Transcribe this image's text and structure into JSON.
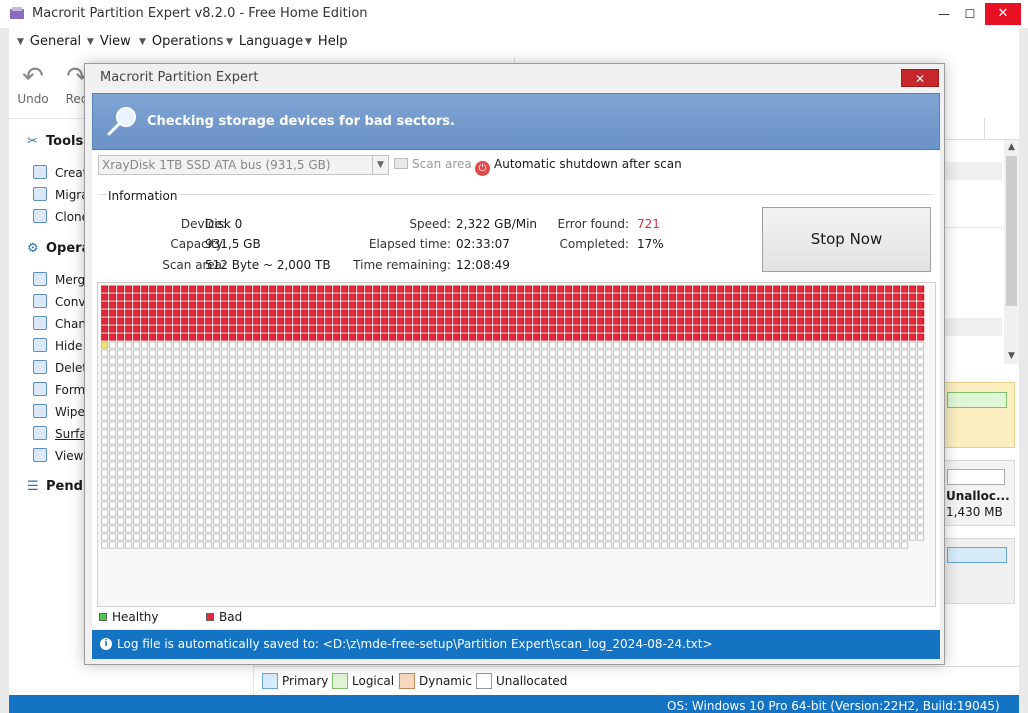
{
  "window": {
    "title": "Macrorit Partition Expert v8.2.0 - Free Home Edition",
    "minimize": "—",
    "maximize": "☐",
    "close": "✕"
  },
  "menu": [
    "General",
    "View",
    "Operations",
    "Language",
    "Help"
  ],
  "toolbar": {
    "undo": "Undo",
    "redo": "Red"
  },
  "sidebar": {
    "tools_header": "Tools",
    "tools_items": [
      "Creat",
      "Migra",
      "Clone"
    ],
    "operations_header": "Operat",
    "operations_items": [
      "Merg",
      "Conv",
      "Chan",
      "Hide",
      "Delet",
      "Form",
      "Wipe",
      "Surfa",
      "View"
    ],
    "pending_header": "Pendin"
  },
  "disk_map": {
    "unalloc_name": "Unalloc...",
    "unalloc_size": "1,430 MB"
  },
  "legend": {
    "primary": "Primary",
    "logical": "Logical",
    "dynamic": "Dynamic",
    "unallocated": "Unallocated"
  },
  "status_bar": "OS: Windows 10 Pro 64-bit (Version:22H2, Build:19045)",
  "dialog": {
    "title": "Macrorit Partition Expert",
    "close": "✕",
    "banner": "Checking storage devices for bad sectors.",
    "disk_select": "XrayDisk 1TB SSD ATA bus (931,5 GB)",
    "scan_area_button": "Scan area",
    "auto_shutdown": "Automatic shutdown after scan",
    "info_label": "Information",
    "device_label": "Device:",
    "device": "Disk 0",
    "capacity_label": "Capacity:",
    "capacity": "931,5 GB",
    "scan_area_label": "Scan area:",
    "scan_area": "512 Byte ~ 2,000 TB",
    "speed_label": "Speed:",
    "speed": "2,322 GB/Min",
    "elapsed_label": "Elapsed time:",
    "elapsed": "02:33:07",
    "remaining_label": "Time remaining:",
    "remaining": "12:08:49",
    "error_label": "Error found:",
    "errors": "721",
    "completed_label": "Completed:",
    "completed": "17%",
    "stop_button": "Stop Now",
    "legend_healthy": "Healthy",
    "legend_bad": "Bad",
    "log_text": "Log file is automatically saved to: <D:\\z\\mde-free-setup\\Partition Expert\\scan_log_2024-08-24.txt>"
  },
  "scan_grid": {
    "columns": 103,
    "rows": 33,
    "bad_cells": 721,
    "current_cells": 1,
    "total_cells_shown": 3397,
    "colors": {
      "bad": "#e8283a",
      "healthy": "#ffffff",
      "current": "#f4e27a",
      "healthy_legend": "#4cc94c"
    }
  }
}
